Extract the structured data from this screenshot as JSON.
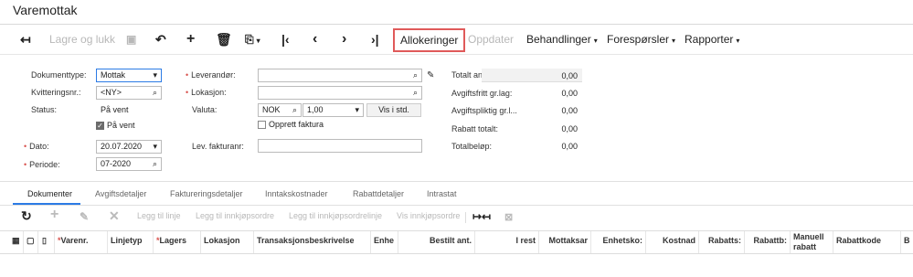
{
  "page": {
    "title": "Varemottak"
  },
  "toolbar": {
    "save_close": "Lagre og lukk",
    "allocations": "Allokeringer",
    "update": "Oppdater",
    "actions": "Behandlinger",
    "inquiries": "Forespørsler",
    "reports": "Rapporter"
  },
  "form": {
    "doc_type_label": "Dokumenttype:",
    "doc_type_value": "Mottak",
    "receipt_nbr_label": "Kvitteringsnr.:",
    "receipt_nbr_value": "<NY>",
    "status_label": "Status:",
    "status_value": "På vent",
    "on_hold_label": "På vent",
    "date_label": "Dato:",
    "date_value": "20.07.2020",
    "period_label": "Periode:",
    "period_value": "07-2020",
    "vendor_label": "Leverandør:",
    "vendor_value": "",
    "location_label": "Lokasjon:",
    "location_value": "",
    "currency_label": "Valuta:",
    "currency_value": "NOK",
    "rate_value": "1,00",
    "base_button": "Vis i std.",
    "create_invoice_label": "Opprett faktura",
    "vendor_invoice_label": "Lev. fakturanr:",
    "vendor_invoice_value": ""
  },
  "totals": {
    "total_qty_label": "Totalt antall:",
    "total_qty": "0,00",
    "tax_exempt_label": "Avgiftsfritt gr.lag:",
    "tax_exempt": "0,00",
    "taxable_label": "Avgiftspliktig gr.l...",
    "taxable": "0,00",
    "discount_label": "Rabatt totalt:",
    "discount": "0,00",
    "total_amount_label": "Totalbeløp:",
    "total_amount": "0,00"
  },
  "tabs": [
    "Dokumenter",
    "Avgiftsdetaljer",
    "Faktureringsdetaljer",
    "Inntakskostnader",
    "Rabattdetaljer",
    "Intrastat"
  ],
  "grid_toolbar": {
    "add_line": "Legg til linje",
    "add_po": "Legg til innkjøpsordre",
    "add_po_line": "Legg til innkjøpsordrelinje",
    "view_po": "Vis innkjøpsordre"
  },
  "columns": [
    "Varenr.",
    "Linjetyp",
    "Lagers",
    "Lokasjon",
    "Transaksjonsbeskrivelse",
    "Enhe",
    "Bestilt ant.",
    "I rest",
    "Mottaksar",
    "Enhetsko:",
    "Kostnad",
    "Rabatts:",
    "Rabattb:",
    "Manuell rabatt",
    "Rabattkode",
    "B"
  ],
  "colors": {
    "accent": "#2c7be5",
    "highlight": "#e05a5a",
    "required": "#d9534f"
  }
}
